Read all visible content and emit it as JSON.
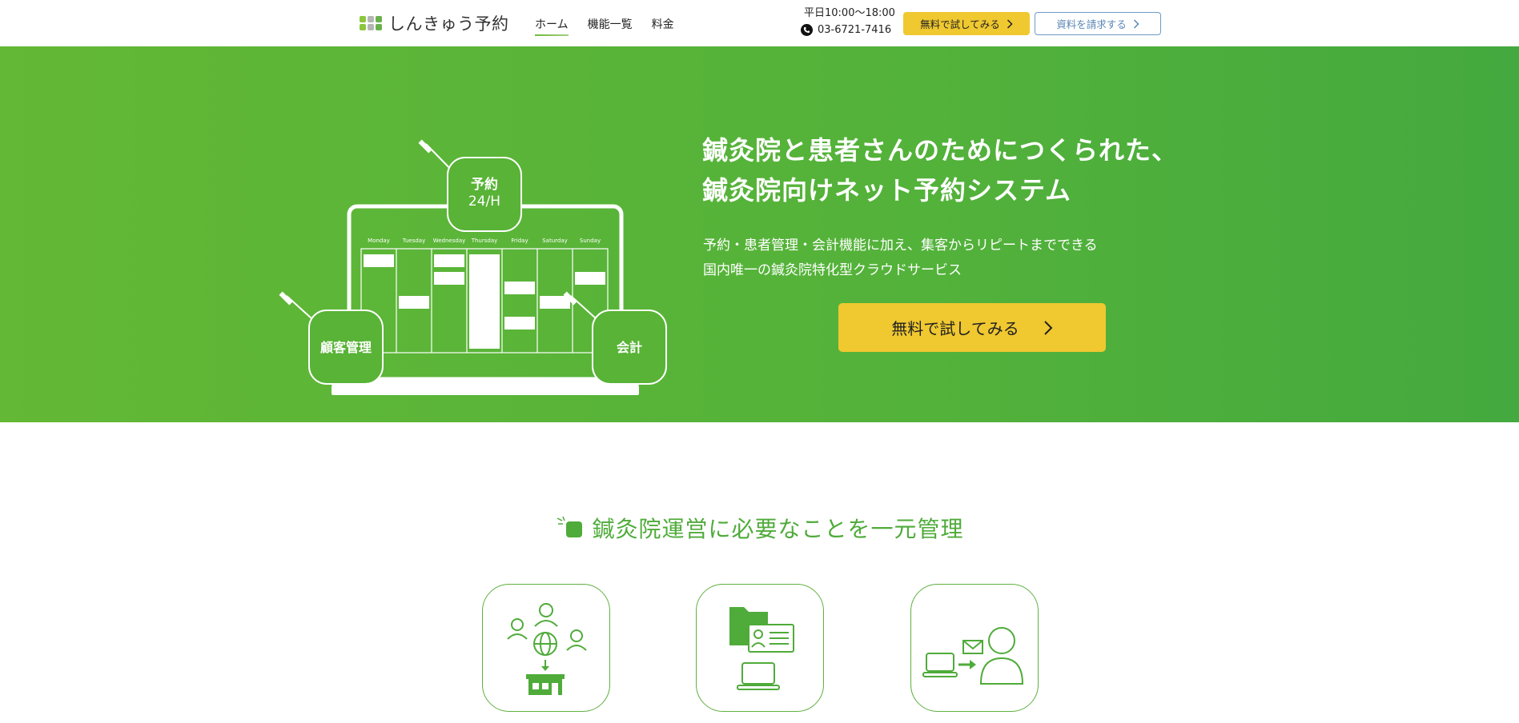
{
  "header": {
    "logo_text": "しんきゅう予約",
    "logo_colors": [
      "#8cc63f",
      "#b5b5b5",
      "#6ab04c",
      "#8cc63f",
      "#b5b5b5",
      "#6ab04c"
    ],
    "nav": [
      {
        "label": "ホーム",
        "active": true
      },
      {
        "label": "機能一覧",
        "active": false
      },
      {
        "label": "料金",
        "active": false
      }
    ],
    "hours": "平日10:00〜18:00",
    "phone": "03-6721-7416",
    "trial_button": "無料で試してみる",
    "docs_button": "資料を請求する"
  },
  "hero": {
    "title_line1": "鍼灸院と患者さんのためにつくられた、",
    "title_line2": "鍼灸院向けネット予約システム",
    "sub_line1": "予約・患者管理・会計機能に加え、集客からリピートまでできる",
    "sub_line2": "国内唯一の鍼灸院特化型クラウドサービス",
    "cta": "無料で試してみる",
    "bubble_reserve_1": "予約",
    "bubble_reserve_2": "24/H",
    "bubble_customer": "顧客管理",
    "bubble_accounting": "会計",
    "days": [
      "Monday",
      "Tuesday",
      "Wednesday",
      "Thursday",
      "Friday",
      "Saturday",
      "Sunday"
    ]
  },
  "section": {
    "title": "鍼灸院運営に必要なことを一元管理"
  },
  "colors": {
    "brand_green": "#4fab3a",
    "hero_green": "#5ab438",
    "cta_yellow": "#f0c830",
    "docs_blue": "#5a86b5"
  }
}
